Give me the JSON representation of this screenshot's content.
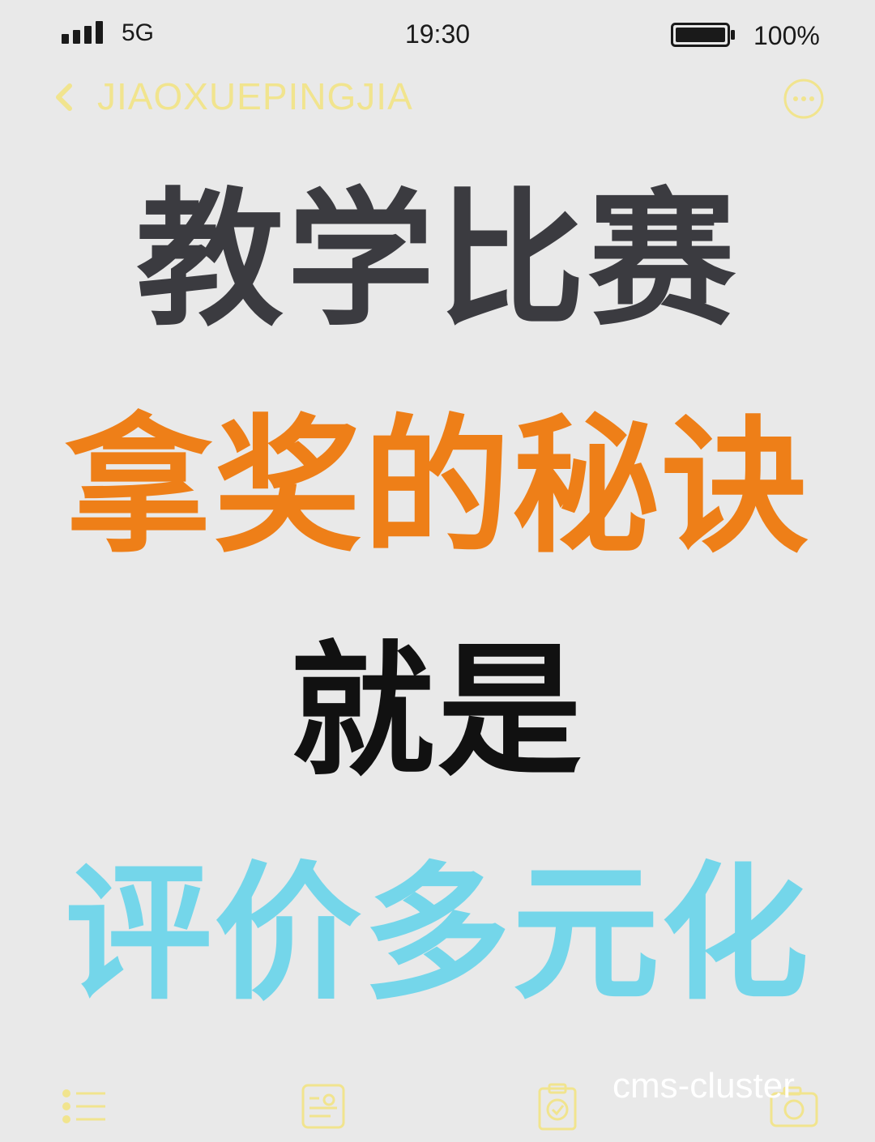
{
  "status_bar": {
    "network": "5G",
    "time": "19:30",
    "battery_percent": "100%"
  },
  "nav": {
    "title": "JIAOXUEPINGJIA"
  },
  "headline": {
    "line1": "教学比赛",
    "line2": "拿奖的秘诀",
    "line3": "就是",
    "line4": "评价多元化"
  },
  "watermark": "cms-cluster",
  "colors": {
    "background": "#e9e9e9",
    "line1": "#3b3b40",
    "line2": "#ee7f18",
    "line3": "#111111",
    "line4": "#74d6ea",
    "nav_accent": "#f1e48e"
  },
  "tabs": [
    {
      "icon": "list-icon"
    },
    {
      "icon": "profile-card-icon"
    },
    {
      "icon": "clipboard-check-icon"
    },
    {
      "icon": "camera-icon"
    }
  ]
}
